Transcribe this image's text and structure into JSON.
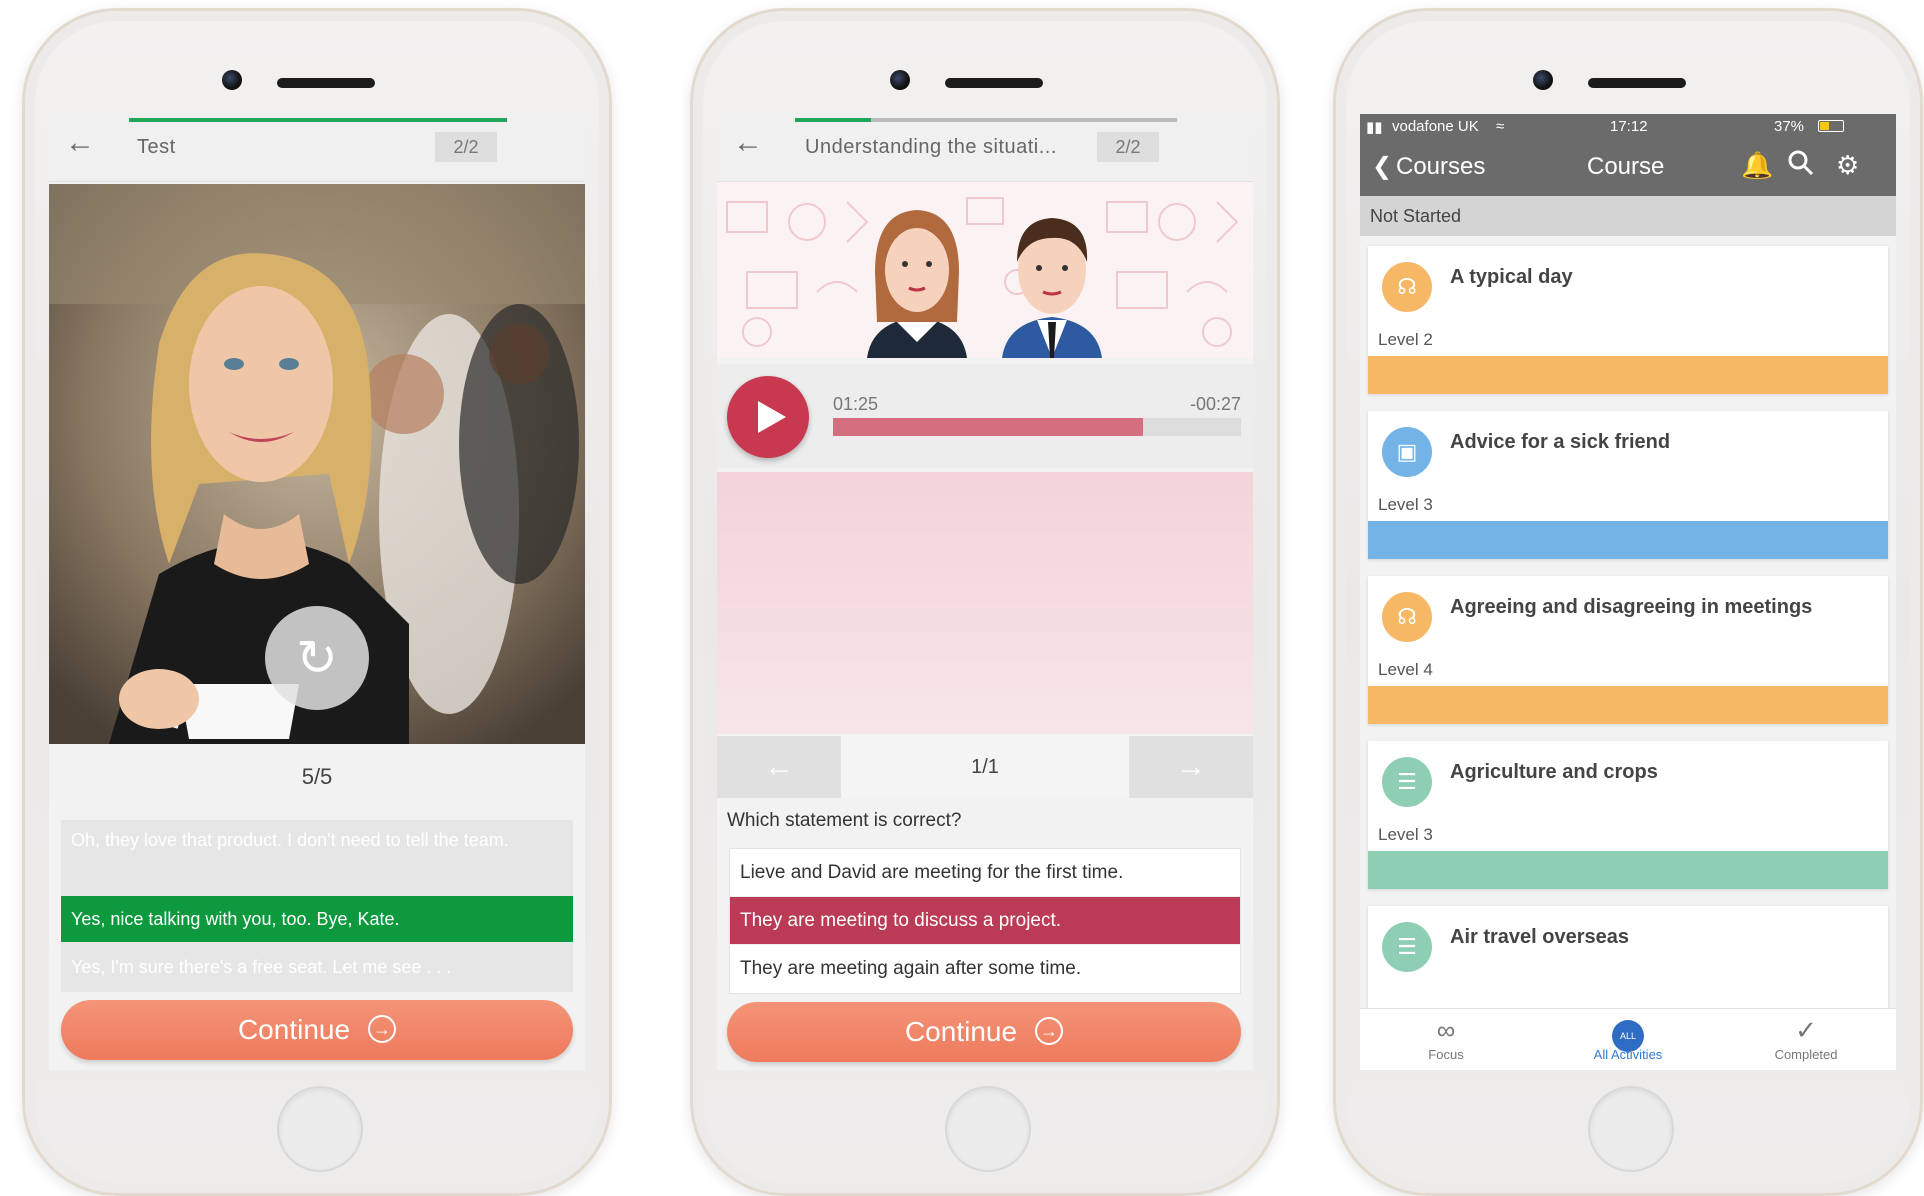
{
  "colors": {
    "green": "#23a557",
    "selected_green": "#0d9a3f",
    "continue": "#ee7a5c",
    "play": "#c8384f",
    "selected_red": "#bb3a55",
    "orange": "#f7b865",
    "blue": "#74b3e6",
    "teal": "#8ecfb4"
  },
  "phone1": {
    "header": {
      "title": "Test",
      "counter": "2/2",
      "progress": 1.0
    },
    "replay_icon": "replay-icon",
    "score": "5/5",
    "answers": [
      {
        "text": "Oh, they love that product. I don't need to tell the team.",
        "state": "faded"
      },
      {
        "text": "Yes, nice talking with you, too. Bye, Kate.",
        "state": "selected"
      },
      {
        "text": "Yes, I'm sure there's a free seat. Let me see . . .",
        "state": "faded"
      }
    ],
    "continue_label": "Continue"
  },
  "phone2": {
    "header": {
      "title": "Understanding the situati...",
      "counter": "2/2",
      "progress": 0.2
    },
    "player": {
      "elapsed": "01:25",
      "remaining": "-00:27",
      "progress": 0.76
    },
    "pager": {
      "prev": "←",
      "label": "1/1",
      "next": "→"
    },
    "question": "Which statement is correct?",
    "options": [
      {
        "text": "Lieve and David are meeting for the first time.",
        "selected": false
      },
      {
        "text": "They are meeting to discuss a project.",
        "selected": true
      },
      {
        "text": "They are meeting again after some time.",
        "selected": false
      }
    ],
    "continue_label": "Continue"
  },
  "phone3": {
    "status": {
      "carrier": "vodafone UK",
      "time": "17:12",
      "battery": "37%"
    },
    "nav": {
      "back_label": "Courses",
      "title": "Course"
    },
    "section": "Not Started",
    "courses": [
      {
        "title": "A typical day",
        "level": "Level 2",
        "color": "#f7b865",
        "icon": "headphones-icon"
      },
      {
        "title": "Advice for a sick friend",
        "level": "Level 3",
        "color": "#74b3e6",
        "icon": "monitor-icon"
      },
      {
        "title": "Agreeing and disagreeing in meetings",
        "level": "Level 4",
        "color": "#f7b865",
        "icon": "headphones-icon"
      },
      {
        "title": "Agriculture and crops",
        "level": "Level 3",
        "color": "#8ecfb4",
        "icon": "document-icon"
      },
      {
        "title": "Air travel overseas",
        "level": "",
        "color": "#8ecfb4",
        "icon": "document-icon"
      }
    ],
    "tabs": [
      {
        "label": "Focus",
        "icon": "binoculars-icon",
        "active": false
      },
      {
        "label": "All Activities",
        "icon": "all-icon",
        "badge": "ALL",
        "active": true
      },
      {
        "label": "Completed",
        "icon": "checkmark-icon",
        "active": false
      }
    ]
  }
}
